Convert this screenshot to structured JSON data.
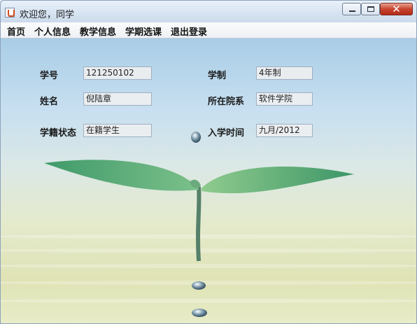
{
  "window": {
    "title": "欢迎您，同学",
    "controls": {
      "minimize_icon": "minimize-icon",
      "maximize_icon": "maximize-icon",
      "close_icon": "close-icon",
      "close_glyph": "✕"
    }
  },
  "menu": {
    "items": [
      "首页",
      "个人信息",
      "教学信息",
      "学期选课",
      "退出登录"
    ]
  },
  "form": {
    "student_id_label": "学号",
    "student_id_value": "121250102",
    "duration_label": "学制",
    "duration_value": "4年制",
    "name_label": "姓名",
    "name_value": "倪陆章",
    "department_label": "所在院系",
    "department_value": "软件学院",
    "status_label": "学籍状态",
    "status_value": "在籍学生",
    "enrollment_label": "入学时间",
    "enrollment_value": "九月/2012"
  },
  "colors": {
    "close_button": "#c8442f",
    "leaf": "#4aa070",
    "background_sky": "#a9cde6"
  }
}
